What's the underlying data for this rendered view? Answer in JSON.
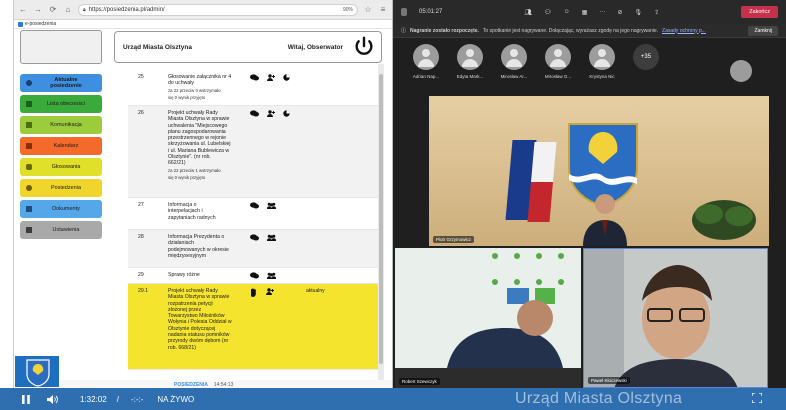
{
  "browser": {
    "url": "https://posiedzenia.pl/admin/",
    "zoom": "90%",
    "bookmark": "e-posiedzenia"
  },
  "header": {
    "institution": "Urząd Miasta Olsztyna",
    "greeting": "Witaj, Obserwator"
  },
  "menu": [
    {
      "label": "Aktualne posiedzenie",
      "color": "#3f8fe0"
    },
    {
      "label": "Lista obecności",
      "color": "#3aaa3a"
    },
    {
      "label": "Komunikacja",
      "color": "#9ccc3c"
    },
    {
      "label": "Kalendarz",
      "color": "#f36a2a"
    },
    {
      "label": "Głosowania",
      "color": "#e0e02a"
    },
    {
      "label": "Posiedzenia",
      "color": "#f0d52a"
    },
    {
      "label": "Dokumenty",
      "color": "#54a7e8"
    },
    {
      "label": "Ustawienia",
      "color": "#a9a9a9"
    }
  ],
  "agenda": [
    {
      "num": "25",
      "lines": [
        "Głosowanie załącznika nr 4",
        "do uchwały"
      ],
      "votes": [
        "za 22 przeciw 0 wstrzymało",
        "się 0 wynik przyjęto"
      ],
      "icons": "3"
    },
    {
      "num": "26",
      "lines": [
        "Projekt uchwały Rady",
        "Miasta Olsztyna w sprawie",
        "uchwalenia \"Miejscowego",
        "planu zagospodarowania",
        "przestrzennego w rejonie",
        "skrzyżowania ul. Lubelskiej",
        "i ul. Mariana Bublewicza w",
        "Olsztynie\". (nr rob.",
        "662/21)"
      ],
      "votes": [
        "za 22 przeciw 1 wstrzymało",
        "się 0 wynik przyjęto"
      ],
      "icons": "3"
    },
    {
      "num": "27",
      "lines": [
        "Informacja o",
        "interpelacjach i",
        "zapytaniach radnych"
      ],
      "votes": [],
      "icons": "2"
    },
    {
      "num": "28",
      "lines": [
        "Informacja Prezydenta o",
        "działaniach",
        "podejmowanych w okresie",
        "międzysesyjnym"
      ],
      "votes": [],
      "icons": "2"
    },
    {
      "num": "29",
      "lines": [
        "Sprawy różne"
      ],
      "votes": [],
      "icons": "2"
    },
    {
      "num": "29.1",
      "lines": [
        "Projekt uchwały Rady",
        "Miasta Olsztyna w sprawie",
        "rozpatrzenia petycji",
        "złożonej przez",
        "Towarzystwo Miłośników",
        "Wołynia i Polesia Oddział w",
        "Olsztynie dotyczącej",
        "nadania statusu pomników",
        "przyrody dwóm dębom (nr",
        "rob. 668/21)"
      ],
      "votes": [],
      "icons": "3",
      "status": "aktualny"
    }
  ],
  "footer": {
    "brand": "POSIEDZENIA",
    "time": "14:54:13"
  },
  "teams": {
    "timer": "05:01:27",
    "end_label": "Zakończ",
    "banner_title": "Nagranie zostało rozpoczęte.",
    "banner_text": "To spotkanie jest nagrywane. Dołączając, wyrażasz zgodę na jego nagrywanie.",
    "banner_link": "Zasady ochrony p...",
    "close_label": "Zamknij",
    "participants": [
      "Adrian Nap...",
      "Edyta Mark...",
      "Mirosław Ar...",
      "Mirosław G...",
      "Krystyna Nic"
    ],
    "more": "+35",
    "speakers": [
      "Piotr Grzymowicz",
      "Robert Szewczyk",
      "Paweł Kłoczewski"
    ]
  },
  "player": {
    "elapsed": "1:32:02",
    "separator": "/",
    "remaining": "-:-:-",
    "live": "NA ŻYWO",
    "brand": "Urząd Miasta Olsztyna"
  }
}
